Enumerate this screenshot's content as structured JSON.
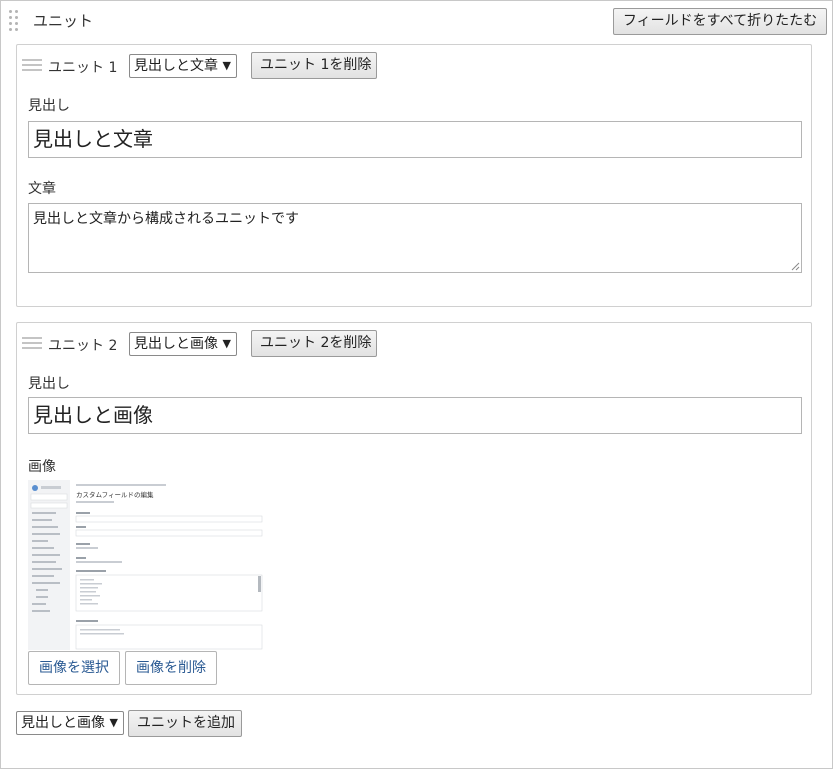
{
  "panel": {
    "title": "ユニット",
    "collapse_all_label": "フィールドをすべて折りたたむ"
  },
  "units": [
    {
      "label": "ユニット 1",
      "type_selected": "見出しと文章",
      "delete_label": "ユニット 1を削除",
      "heading_label": "見出し",
      "heading_value": "見出しと文章",
      "body_label": "文章",
      "body_value": "見出しと文章から構成されるユニットです"
    },
    {
      "label": "ユニット 2",
      "type_selected": "見出しと画像",
      "delete_label": "ユニット 2を削除",
      "heading_label": "見出し",
      "heading_value": "見出しと画像",
      "image_label": "画像",
      "select_image_label": "画像を選択",
      "delete_image_label": "画像を削除",
      "image_preview": {
        "page_title": "カスタムフィールドの編集"
      }
    }
  ],
  "footer": {
    "type_selected": "見出しと画像",
    "add_label": "ユニットを追加"
  },
  "icons": {
    "drag_grip": "grip-dots-icon",
    "unit_handle": "hamburger-handle-icon",
    "dropdown": "caret-down-icon",
    "resize": "resize-grip-icon"
  },
  "colors": {
    "image_button_text": "#2a5a93",
    "border": "#c8c8c8"
  }
}
